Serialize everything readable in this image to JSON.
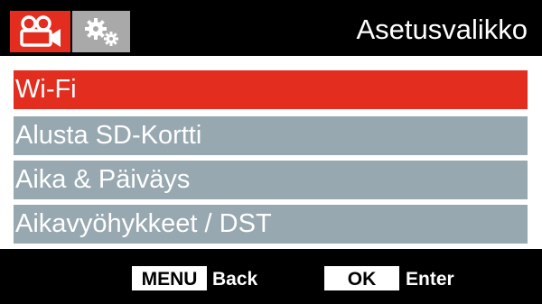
{
  "header": {
    "title": "Asetusvalikko",
    "tabs": [
      {
        "icon": "video-camera-icon",
        "active": true
      },
      {
        "icon": "gears-icon",
        "active": false
      }
    ]
  },
  "menu": {
    "items": [
      {
        "label": "Wi-Fi",
        "selected": true
      },
      {
        "label": "Alusta SD-Kortti",
        "selected": false
      },
      {
        "label": "Aika & Päiväys",
        "selected": false
      },
      {
        "label": "Aikavyöhykkeet / DST",
        "selected": false
      }
    ]
  },
  "footer": {
    "menu_key": "MENU",
    "menu_action": "Back",
    "ok_key": "OK",
    "ok_action": "Enter"
  },
  "colors": {
    "accent": "#e32d1f",
    "item_bg": "#97a8b0",
    "inactive_tab": "#a9a9a9"
  }
}
